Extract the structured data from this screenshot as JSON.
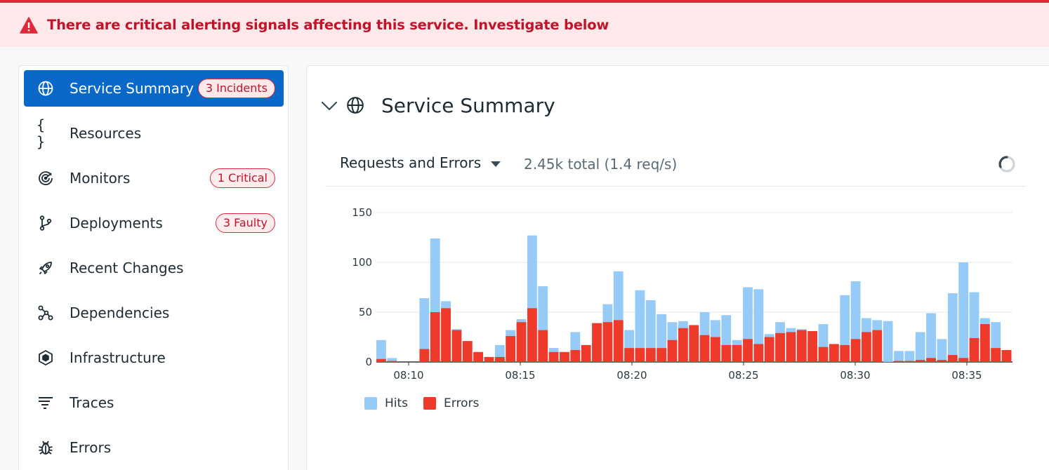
{
  "alert": {
    "message": "There are critical alerting signals affecting this service. Investigate below",
    "icon": "warning-triangle-icon",
    "color": "#c0142a"
  },
  "sidebar": {
    "items": [
      {
        "label": "Service Summary",
        "icon": "globe-icon",
        "badge": "3 Incidents",
        "active": true
      },
      {
        "label": "Resources",
        "icon": "braces-icon",
        "badge": ""
      },
      {
        "label": "Monitors",
        "icon": "monitor-target-icon",
        "badge": "1 Critical"
      },
      {
        "label": "Deployments",
        "icon": "git-branch-icon",
        "badge": "3 Faulty"
      },
      {
        "label": "Recent Changes",
        "icon": "rocket-icon",
        "badge": ""
      },
      {
        "label": "Dependencies",
        "icon": "dependencies-graph-icon",
        "badge": ""
      },
      {
        "label": "Infrastructure",
        "icon": "hexagon-icon",
        "badge": ""
      },
      {
        "label": "Traces",
        "icon": "traces-icon",
        "badge": ""
      },
      {
        "label": "Errors",
        "icon": "bug-icon",
        "badge": ""
      }
    ]
  },
  "main": {
    "title": "Service Summary",
    "metric_selector": "Requests and Errors",
    "total": "2.45k total (1.4 req/s)"
  },
  "colors": {
    "accent": "#0a68c8",
    "hits": "#96cbf7",
    "errors": "#ee3a2a",
    "critical": "#e0283b"
  },
  "chart_data": {
    "type": "bar",
    "stacked": true,
    "x_tick_labels": [
      "08:10",
      "08:15",
      "08:20",
      "08:25",
      "08:30",
      "08:35"
    ],
    "y_ticks": [
      0,
      50,
      100,
      150
    ],
    "ylim": [
      0,
      150
    ],
    "grid": true,
    "legend_position": "bottom-left",
    "series": [
      {
        "name": "Hits",
        "values": [
          22,
          4,
          0,
          0,
          64,
          124,
          61,
          33,
          21,
          10,
          5,
          17,
          32,
          43,
          127,
          76,
          14,
          10,
          30,
          17,
          39,
          58,
          91,
          32,
          72,
          62,
          48,
          40,
          41,
          37,
          50,
          42,
          47,
          22,
          75,
          73,
          28,
          40,
          34,
          33,
          20,
          38,
          18,
          67,
          81,
          44,
          42,
          41,
          11,
          11,
          30,
          49,
          23,
          69,
          100,
          70,
          44,
          40
        ]
      },
      {
        "name": "Errors",
        "values": [
          3,
          1,
          0,
          0,
          13,
          50,
          54,
          32,
          21,
          10,
          5,
          5,
          26,
          40,
          54,
          32,
          10,
          10,
          12,
          17,
          39,
          40,
          42,
          14,
          14,
          14,
          14,
          22,
          34,
          37,
          27,
          25,
          17,
          17,
          23,
          18,
          25,
          29,
          30,
          32,
          31,
          15,
          18,
          17,
          23,
          30,
          32,
          0,
          1,
          1,
          2,
          4,
          2,
          7,
          4,
          24,
          38,
          14,
          12
        ]
      }
    ],
    "notes": "Hits bars are drawn behind Errors bars; each Hits value is the total bar height."
  }
}
